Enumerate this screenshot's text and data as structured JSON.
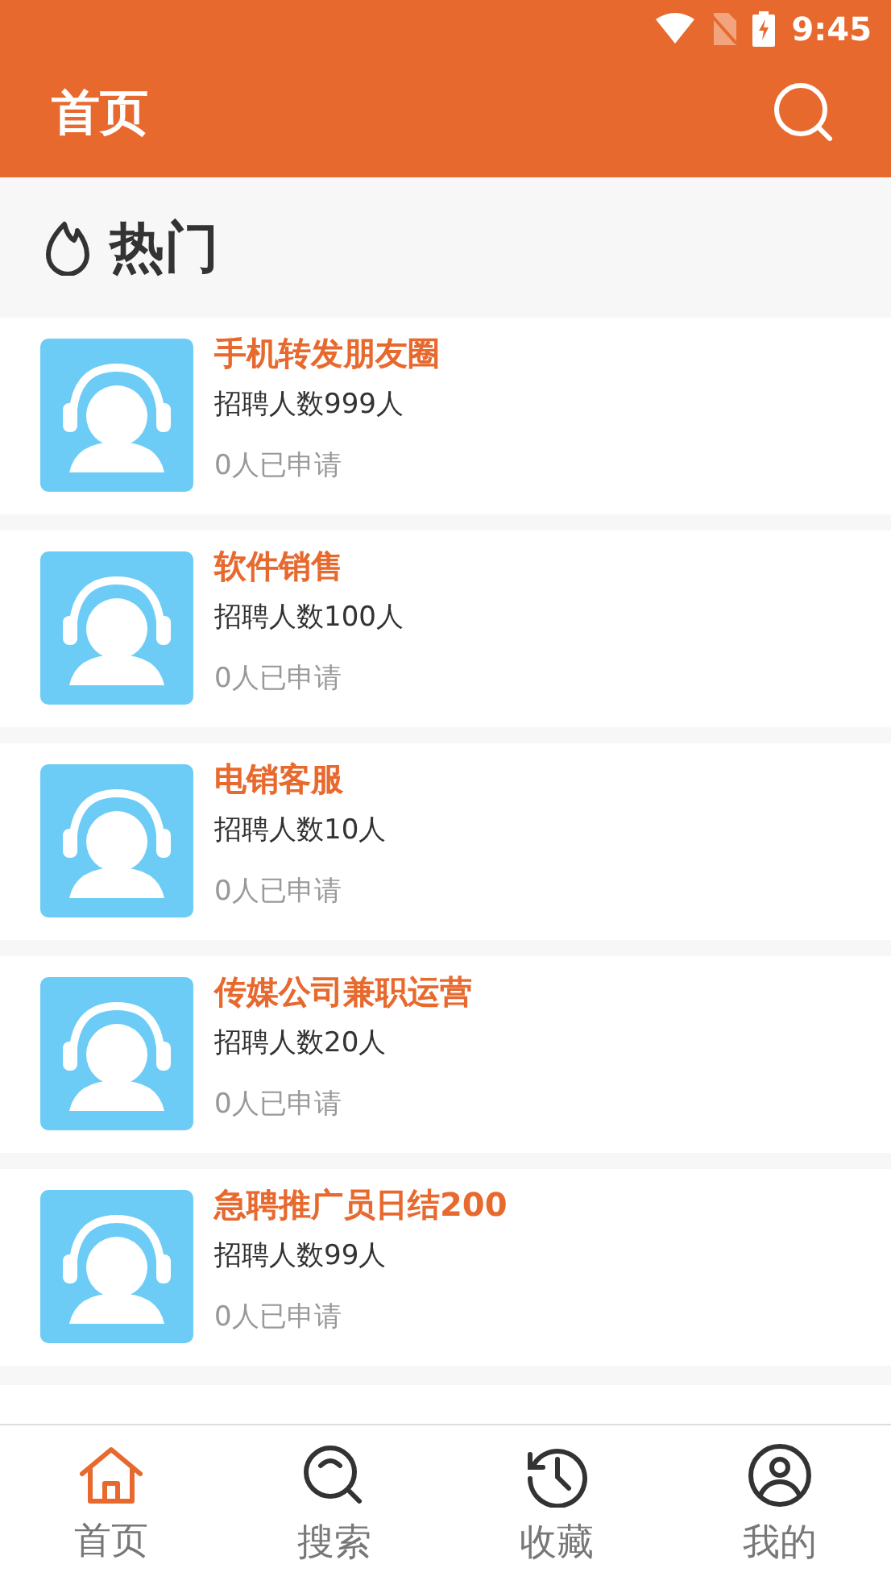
{
  "status_bar": {
    "time": "9:45"
  },
  "header": {
    "title": "首页"
  },
  "section": {
    "title": "热门"
  },
  "jobs": [
    {
      "title": "手机转发朋友圈",
      "quota": "招聘人数999人",
      "applied": "0人已申请"
    },
    {
      "title": "软件销售",
      "quota": "招聘人数100人",
      "applied": "0人已申请"
    },
    {
      "title": "电销客服",
      "quota": "招聘人数10人",
      "applied": "0人已申请"
    },
    {
      "title": "传媒公司兼职运营",
      "quota": "招聘人数20人",
      "applied": "0人已申请"
    },
    {
      "title": "急聘推广员日结200",
      "quota": "招聘人数99人",
      "applied": "0人已申请"
    }
  ],
  "tabs": [
    {
      "label": "首页",
      "kind": "home",
      "selected": true
    },
    {
      "label": "搜索",
      "kind": "search",
      "selected": false
    },
    {
      "label": "收藏",
      "kind": "history",
      "selected": false
    },
    {
      "label": "我的",
      "kind": "user",
      "selected": false
    }
  ]
}
